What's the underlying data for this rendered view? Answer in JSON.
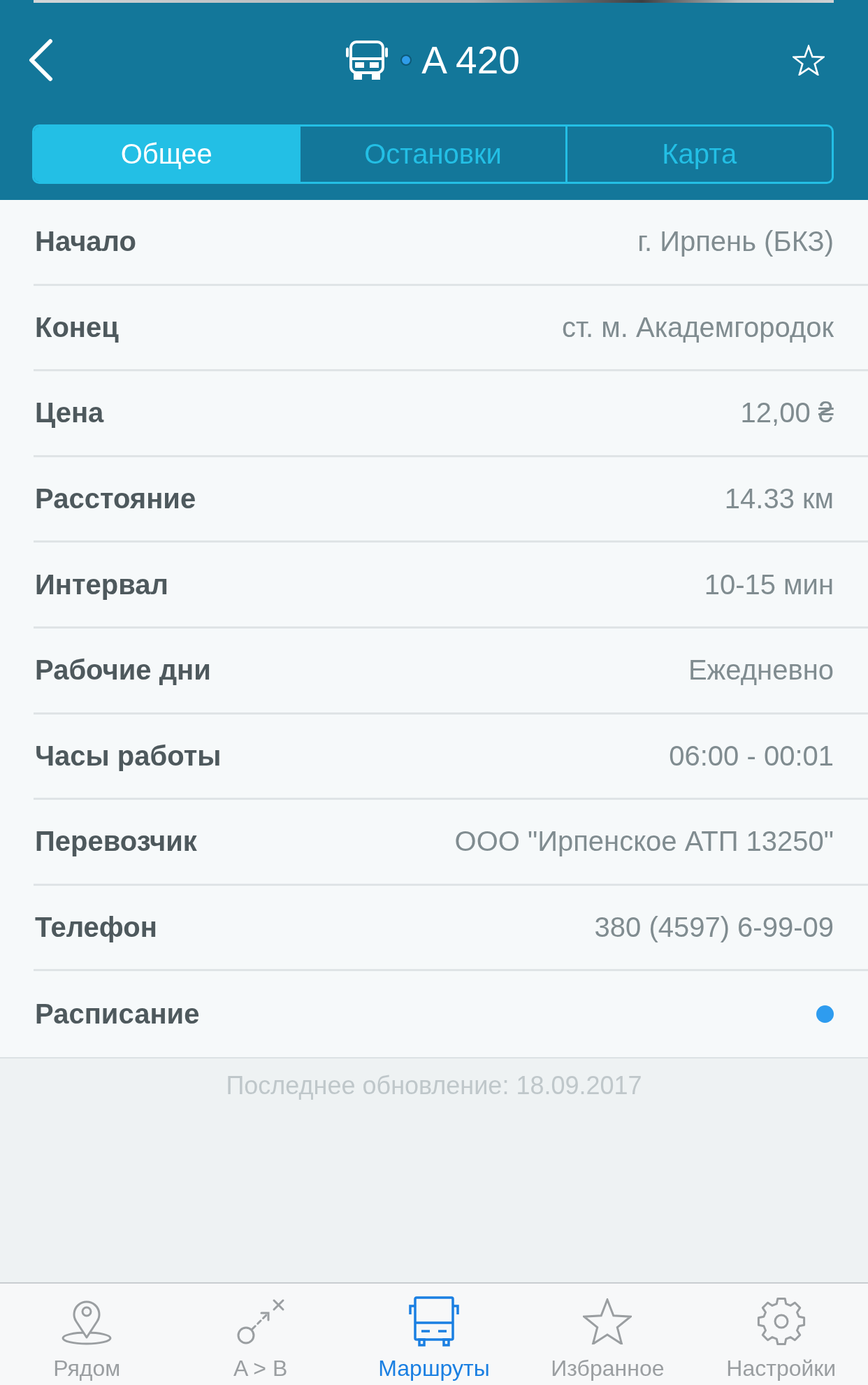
{
  "header": {
    "title": "A 420",
    "favorite": false
  },
  "segments": [
    {
      "label": "Общее",
      "selected": true
    },
    {
      "label": "Остановки",
      "selected": false
    },
    {
      "label": "Карта",
      "selected": false
    }
  ],
  "details": [
    {
      "kind": "text",
      "label": "Начало",
      "value": "г. Ирпень (БКЗ)"
    },
    {
      "kind": "text",
      "label": "Конец",
      "value": "ст. м. Академгородок"
    },
    {
      "kind": "text",
      "label": "Цена",
      "value": "12,00 ₴"
    },
    {
      "kind": "text",
      "label": "Расстояние",
      "value": "14.33 км"
    },
    {
      "kind": "text",
      "label": "Интервал",
      "value": "10-15 мин"
    },
    {
      "kind": "text",
      "label": "Рабочие дни",
      "value": "Ежедневно"
    },
    {
      "kind": "text",
      "label": "Часы работы",
      "value": "06:00 - 00:01"
    },
    {
      "kind": "text",
      "label": "Перевозчик",
      "value": "ООО \"Ирпенское АТП 13250\""
    },
    {
      "kind": "text",
      "label": "Телефон",
      "value": "380 (4597) 6-99-09"
    },
    {
      "kind": "dot",
      "label": "Расписание"
    }
  ],
  "last_update": "Последнее обновление: 18.09.2017",
  "tab_bar": [
    {
      "label": "Рядом",
      "selected": false
    },
    {
      "label": "A > B",
      "selected": false
    },
    {
      "label": "Маршруты",
      "selected": true
    },
    {
      "label": "Избранное",
      "selected": false
    },
    {
      "label": "Настройки",
      "selected": false
    }
  ]
}
